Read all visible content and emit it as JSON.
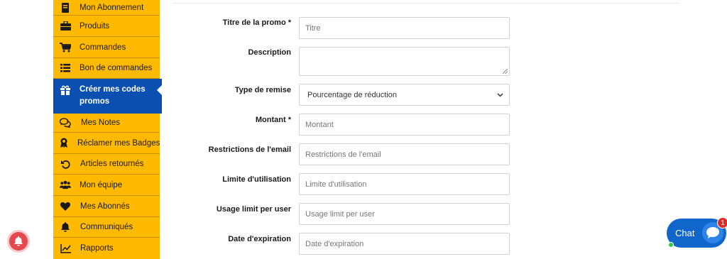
{
  "sidebar": {
    "items": [
      {
        "label": "Mon Abonnement",
        "icon": "book-icon"
      },
      {
        "label": "Produits",
        "icon": "briefcase-icon"
      },
      {
        "label": "Commandes",
        "icon": "cart-icon"
      },
      {
        "label": "Bon de commandes",
        "icon": "list-icon"
      },
      {
        "label": "Créer mes codes promos",
        "icon": "gift-icon"
      },
      {
        "label": "Mes Notes",
        "icon": "chat-bubbles-icon"
      },
      {
        "label": "Réclamer mes Badges",
        "icon": "award-icon"
      },
      {
        "label": "Articles retournés",
        "icon": "undo-icon"
      },
      {
        "label": "Mon équipe",
        "icon": "team-icon"
      },
      {
        "label": "Mes Abonnés",
        "icon": "heart-icon"
      },
      {
        "label": "Communiqués",
        "icon": "bell-icon"
      },
      {
        "label": "Rapports",
        "icon": "chart-line-icon"
      }
    ],
    "active_index": 4,
    "colors": {
      "background": "#ffba00",
      "active": "#0b4fb0"
    }
  },
  "form": {
    "title": {
      "label": "Titre de la promo *",
      "placeholder": "Titre"
    },
    "description": {
      "label": "Description",
      "placeholder": ""
    },
    "discount_type": {
      "label": "Type de remise",
      "value": "Pourcentage de réduction"
    },
    "amount": {
      "label": "Montant *",
      "placeholder": "Montant"
    },
    "email_restrictions": {
      "label": "Restrictions de l'email",
      "placeholder": "Restrictions de l'email"
    },
    "usage_limit": {
      "label": "Limite d'utilisation",
      "placeholder": "Limite d'utilisation"
    },
    "usage_limit_per_user": {
      "label": "Usage limit per user",
      "placeholder": "Usage limit per user"
    },
    "expiry_date": {
      "label": "Date d'expiration",
      "placeholder": "Date d'expiration"
    }
  },
  "chat": {
    "label": "Chat",
    "badge": "1"
  }
}
